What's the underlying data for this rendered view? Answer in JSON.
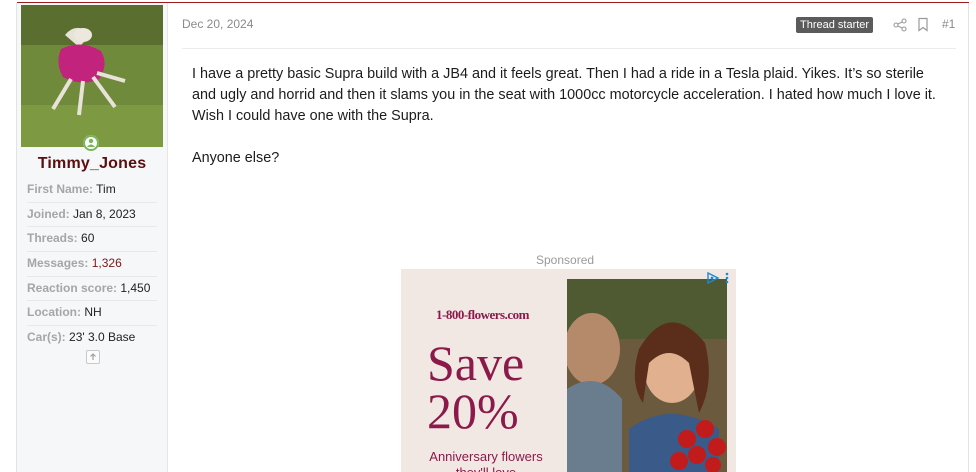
{
  "post": {
    "date": "Dec 20, 2024",
    "badge": "Thread starter",
    "number": "#1",
    "paragraphs": [
      "I have a pretty basic Supra build with a JB4 and it feels great. Then I had a ride in a Tesla plaid. Yikes. It’s so sterile and ugly and horrid and then it slams you in the seat with 1000cc motorcycle acceleration. I hated how much I love it. Wish I could have one with the Supra.",
      "Anyone else?"
    ]
  },
  "user": {
    "name": "Timmy_Jones",
    "stats": [
      {
        "key": "First Name:",
        "value": "Tim"
      },
      {
        "key": "Joined:",
        "value": "Jan 8, 2023"
      },
      {
        "key": "Threads:",
        "value": "60"
      },
      {
        "key": "Messages:",
        "value": "1,326"
      },
      {
        "key": "Reaction score:",
        "value": "1,450"
      },
      {
        "key": "Location:",
        "value": "NH"
      },
      {
        "key": "Car(s):",
        "value": "23' 3.0 Base"
      }
    ]
  },
  "ad": {
    "label": "Sponsored",
    "brand": "1-800-flowers.com",
    "headline1": "Save",
    "headline2": "20%",
    "tagline": "Anniversary flowers they'll love"
  },
  "colors": {
    "accent": "#9b1c1c",
    "username": "#5a0f0f",
    "ad_text": "#8b1a4b",
    "online": "#7ab55c"
  },
  "icons": [
    "online-status-icon",
    "share-icon",
    "bookmark-icon",
    "expand-icon",
    "ad-choices-icon",
    "ad-menu-icon"
  ]
}
